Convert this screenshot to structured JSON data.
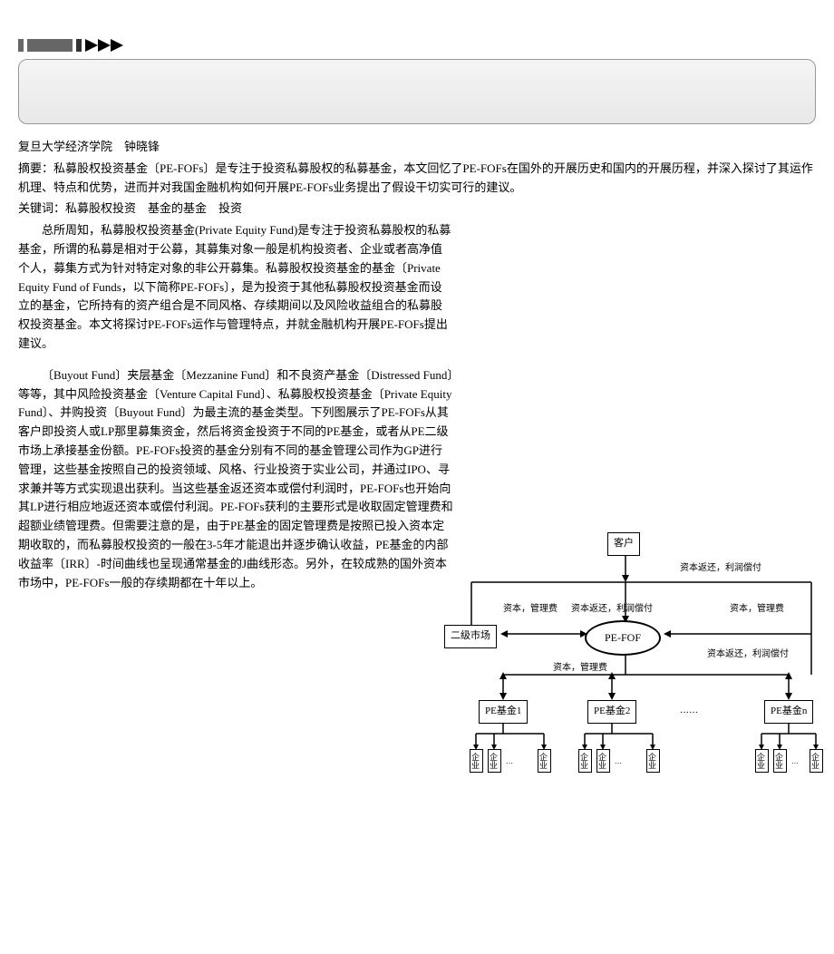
{
  "author_line": "复旦大学经济学院　钟晓锋",
  "abstract": "摘要：私募股权投资基金〔PE-FOFs〕是专注于投资私募股权的私募基金，本文回忆了PE-FOFs在国外的开展历史和国内的开展历程，并深入探讨了其运作机理、特点和优势，进而并对我国金融机构如何开展PE-FOFs业务提出了假设干切实可行的建议。",
  "keywords": "关键词：私募股权投资　基金的基金　投资",
  "para1": "总所周知，私募股权投资基金(Private Equity Fund)是专注于投资私募股权的私募基金，所谓的私募是相对于公募，其募集对象一般是机构投资者、企业或者高净值个人，募集方式为针对特定对象的非公开募集。私募股权投资基金的基金〔Private Equity Fund of Funds，以下简称PE-FOFs〕，是为投资于其他私募股权投资基金而设立的基金，它所持有的资产组合是不同风格、存续期间以及风险收益组合的私募股权投资基金。本文将探讨PE-FOFs运作与管理特点，并就金融机构开展PE-FOFs提出建议。",
  "para2": "〔Buyout Fund〕夹层基金〔Mezzanine Fund〕和不良资产基金〔Distressed Fund〕等等，其中风险投资基金〔Venture Capital Fund〕、私募股权投资基金〔Private Equity Fund〕、并购投资〔Buyout Fund〕为最主流的基金类型。下列图展示了PE-FOFs从其客户即投资人或LP那里募集资金，然后将资金投资于不同的PE基金，或者从PE二级市场上承接基金份额。PE-FOFs投资的基金分别有不同的基金管理公司作为GP进行管理，这些基金按照自己的投资领域、风格、行业投资于实业公司，并通过IPO、寻求兼并等方式实现退出获利。当这些基金返还资本或偿付利润时，PE-FOFs也开始向其LP进行相应地返还资本或偿付利润。PE-FOFs获利的主要形式是收取固定管理费和超额业绩管理费。但需要注意的是，由于PE基金的固定管理费是按照已投入资本定期收取的，而私募股权投资的一般在3-5年才能退出并逐步确认收益，PE基金的内部收益率〔IRR〕-时间曲线也呈现通常基金的J曲线形态。另外，在较成熟的国外资本市场中，PE-FOFs一般的存续期都在十年以上。",
  "diagram": {
    "customer": "客户",
    "secondary_market": "二级市场",
    "pe_fof": "PE-FOF",
    "pe_fund1": "PE基金1",
    "pe_fund2": "PE基金2",
    "pe_fundn": "PE基金n",
    "enterprise": "企业",
    "label_capital_return": "资本返还，利润偿付",
    "label_capital_mgmt": "资本，管理费",
    "dots": "……"
  }
}
